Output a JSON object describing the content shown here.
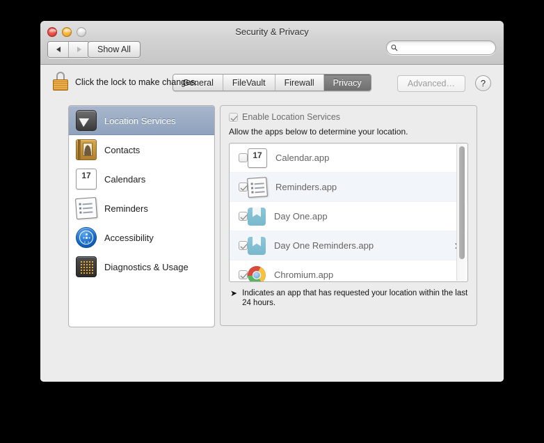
{
  "window": {
    "title": "Security & Privacy",
    "traffic_lights": [
      "close",
      "minimize",
      "zoom"
    ]
  },
  "toolbar": {
    "back_label": "◀",
    "forward_label": "▶",
    "show_all_label": "Show All",
    "search": {
      "value": "",
      "placeholder": "",
      "icon": "search-icon"
    }
  },
  "tabs": [
    {
      "label": "General",
      "selected": false
    },
    {
      "label": "FileVault",
      "selected": false
    },
    {
      "label": "Firewall",
      "selected": false
    },
    {
      "label": "Privacy",
      "selected": true
    }
  ],
  "sidebar": {
    "items": [
      {
        "label": "Location Services",
        "icon": "location-arrow-icon",
        "selected": true
      },
      {
        "label": "Contacts",
        "icon": "address-book-icon",
        "selected": false
      },
      {
        "label": "Calendars",
        "icon": "calendar-icon",
        "selected": false
      },
      {
        "label": "Reminders",
        "icon": "reminders-notepad-icon",
        "selected": false
      },
      {
        "label": "Accessibility",
        "icon": "accessibility-icon",
        "selected": false
      },
      {
        "label": "Diagnostics & Usage",
        "icon": "diagnostics-icon",
        "selected": false
      }
    ]
  },
  "main": {
    "enable_checkbox": {
      "label": "Enable Location Services",
      "checked": true,
      "disabled": true
    },
    "description": "Allow the apps below to determine your location.",
    "apps": [
      {
        "name": "Calendar.app",
        "checked": false,
        "icon": "calendar-icon",
        "recent_location": false
      },
      {
        "name": "Reminders.app",
        "checked": true,
        "icon": "reminders-notepad-icon",
        "recent_location": false
      },
      {
        "name": "Day One.app",
        "checked": true,
        "icon": "day-one-icon",
        "recent_location": false
      },
      {
        "name": "Day One Reminders.app",
        "checked": true,
        "icon": "day-one-icon",
        "recent_location": true
      },
      {
        "name": "Chromium.app",
        "checked": true,
        "icon": "chromium-icon",
        "recent_location": false
      }
    ],
    "footnote": "Indicates an app that has requested your location within the last 24 hours.",
    "footnote_arrow": "➤",
    "calendar_day_number": "17"
  },
  "bottom": {
    "lock_icon": "locked-padlock-icon",
    "lock_text": "Click the lock to make changes.",
    "advanced_label": "Advanced…",
    "help_label": "?"
  },
  "colors": {
    "selection_blue": "#8fa2bd",
    "tab_selected": "#7a7a7a",
    "lock_gold": "#d4912f",
    "window_bg": "#ececec",
    "desktop": "#000000"
  }
}
